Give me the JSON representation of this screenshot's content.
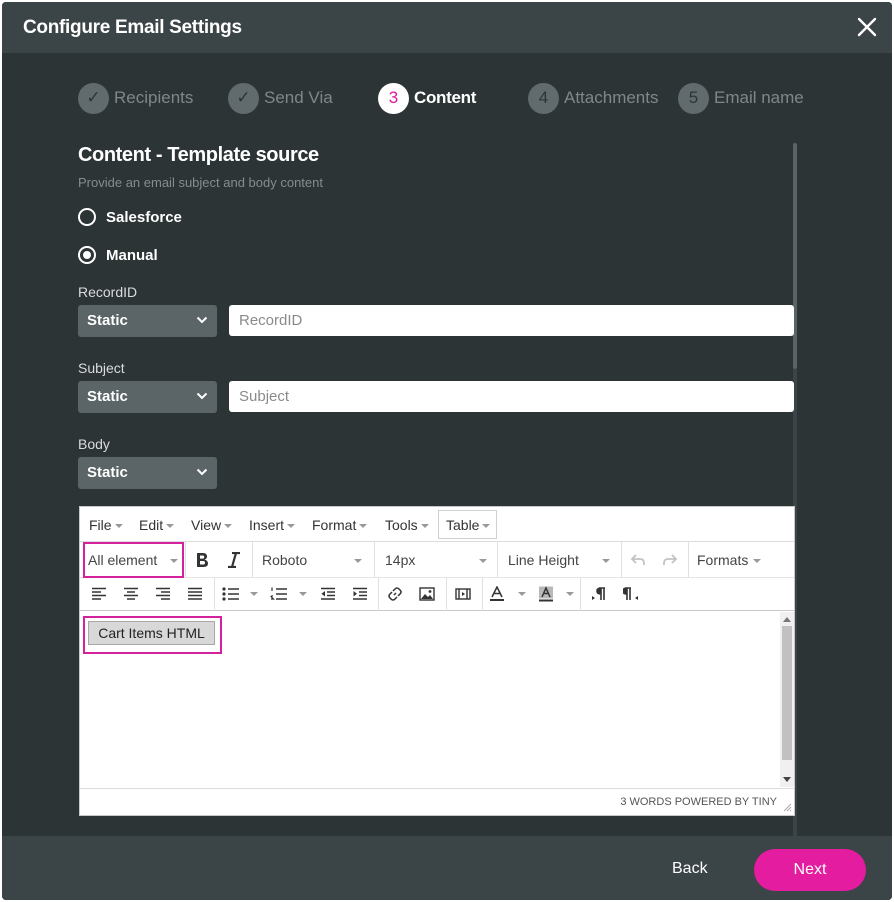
{
  "dialog": {
    "title": "Configure Email Settings"
  },
  "steps": [
    {
      "marker": "✓",
      "label": "Recipients",
      "state": "done"
    },
    {
      "marker": "✓",
      "label": "Send Via",
      "state": "done"
    },
    {
      "marker": "3",
      "label": "Content",
      "state": "active"
    },
    {
      "marker": "4",
      "label": "Attachments",
      "state": "pending"
    },
    {
      "marker": "5",
      "label": "Email name",
      "state": "pending"
    }
  ],
  "section": {
    "title": "Content - Template source",
    "subtitle": "Provide an email subject and body content"
  },
  "source_options": [
    {
      "label": "Salesforce",
      "checked": false
    },
    {
      "label": "Manual",
      "checked": true
    }
  ],
  "fields": {
    "record_id": {
      "label": "RecordID",
      "mode": "Static",
      "placeholder": "RecordID",
      "value": ""
    },
    "subject": {
      "label": "Subject",
      "mode": "Static",
      "placeholder": "Subject",
      "value": ""
    },
    "body": {
      "label": "Body",
      "mode": "Static"
    }
  },
  "editor": {
    "menus": [
      "File",
      "Edit",
      "View",
      "Insert",
      "Format",
      "Tools",
      "Table"
    ],
    "element_select": "All element",
    "font_family": "Roboto",
    "font_size": "14px",
    "line_height": "Line Height",
    "formats": "Formats",
    "content_button": "Cart Items HTML",
    "status": "3 WORDS POWERED BY TINY"
  },
  "footer": {
    "back_label": "Back",
    "next_label": "Next"
  },
  "colors": {
    "accent": "#e41c9f",
    "background": "#2d3436",
    "header": "#3b4447"
  }
}
